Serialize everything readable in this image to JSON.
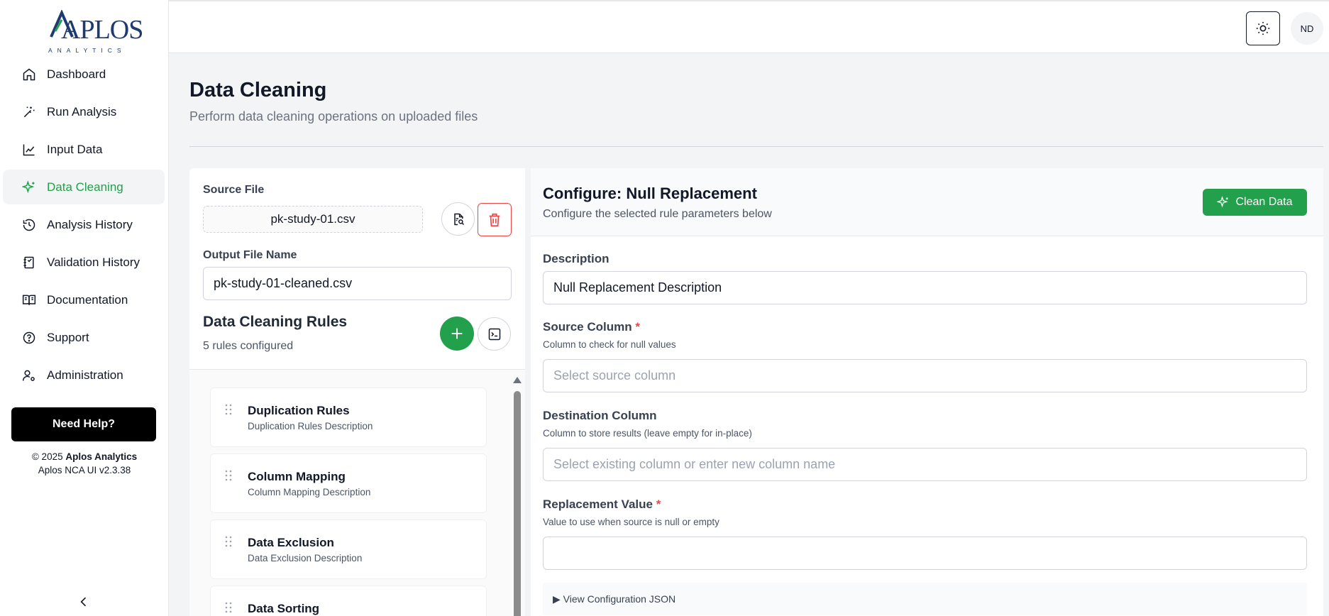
{
  "brand": {
    "wordmark": "APLOS",
    "tagline": "ANALYTICS"
  },
  "sidebar": {
    "items": [
      {
        "label": "Dashboard",
        "icon": "home-icon"
      },
      {
        "label": "Run Analysis",
        "icon": "wand-icon"
      },
      {
        "label": "Input Data",
        "icon": "line-chart-icon"
      },
      {
        "label": "Data Cleaning",
        "icon": "sparkles-icon",
        "active": true
      },
      {
        "label": "Analysis History",
        "icon": "history-icon"
      },
      {
        "label": "Validation History",
        "icon": "notebook-icon"
      },
      {
        "label": "Documentation",
        "icon": "book-icon"
      },
      {
        "label": "Support",
        "icon": "help-circle-icon"
      },
      {
        "label": "Administration",
        "icon": "user-cog-icon"
      }
    ],
    "help_button": "Need Help?",
    "copyright_prefix": "© 2025 ",
    "copyright_company": "Aplos Analytics",
    "version": "Aplos NCA UI v2.3.38"
  },
  "topbar": {
    "avatar_initials": "ND"
  },
  "page": {
    "title": "Data Cleaning",
    "subtitle": "Perform data cleaning operations on uploaded files"
  },
  "left_panel": {
    "source_file_label": "Source File",
    "source_file_name": "pk-study-01.csv",
    "output_label": "Output File Name",
    "output_value": "pk-study-01-cleaned.csv",
    "rules_title": "Data Cleaning Rules",
    "rules_count": "5 rules configured",
    "rules": [
      {
        "name": "Duplication Rules",
        "description": "Duplication Rules Description"
      },
      {
        "name": "Column Mapping",
        "description": "Column Mapping Description"
      },
      {
        "name": "Data Exclusion",
        "description": "Data Exclusion Description"
      },
      {
        "name": "Data Sorting",
        "description": ""
      }
    ]
  },
  "right_panel": {
    "title": "Configure: Null Replacement",
    "subtitle": "Configure the selected rule parameters below",
    "clean_button": "Clean Data",
    "description_label": "Description",
    "description_value": "Null Replacement Description",
    "source_column_label": "Source Column",
    "source_column_help": "Column to check for null values",
    "source_column_placeholder": "Select source column",
    "destination_label": "Destination Column",
    "destination_help": "Column to store results (leave empty for in-place)",
    "destination_placeholder": "Select existing column or enter new column name",
    "replacement_label": "Replacement Value",
    "replacement_help": "Value to use when source is null or empty",
    "replacement_value": "",
    "required_marker": "*",
    "json_toggle": "▶ View Configuration JSON"
  },
  "colors": {
    "accent": "#22a04b",
    "danger": "#ef4444",
    "brand": "#1e3a6e"
  }
}
